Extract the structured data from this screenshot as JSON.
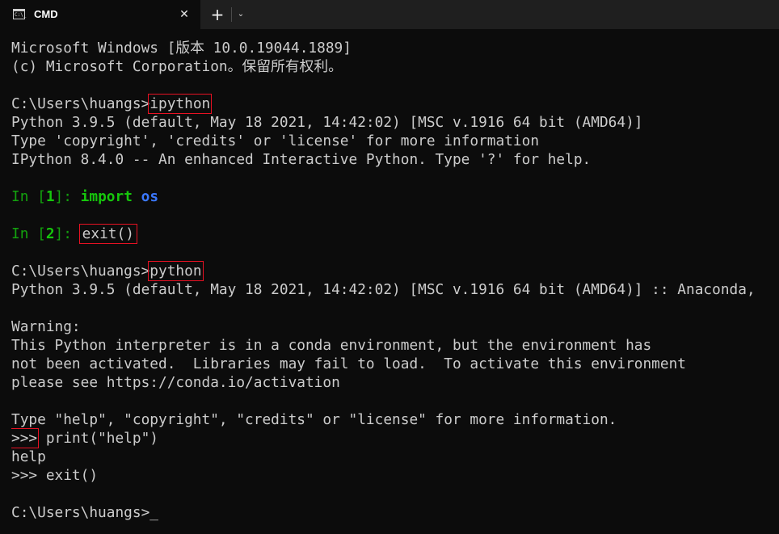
{
  "window": {
    "tab_title": "CMD",
    "tab_icon_text": "C:\\_",
    "close_glyph": "✕",
    "new_tab_glyph": "+",
    "dropdown_glyph": "⌄"
  },
  "terminal": {
    "banner_1": "Microsoft Windows [版本 10.0.19044.1889]",
    "banner_2": "(c) Microsoft Corporation。保留所有权利。",
    "prompt_1": "C:\\Users\\huangs>",
    "cmd_1": "ipython",
    "ipy_ver_1": "Python 3.9.5 (default, May 18 2021, 14:42:02) [MSC v.1916 64 bit (AMD64)]",
    "ipy_ver_2": "Type 'copyright', 'credits' or 'license' for more information",
    "ipy_ver_3": "IPython 8.4.0 -- An enhanced Interactive Python. Type '?' for help.",
    "in1_prefix": "In [",
    "in1_num": "1",
    "in1_suffix": "]: ",
    "in1_kw": "import",
    "in1_sp": " ",
    "in1_mod": "os",
    "in2_prefix": "In [",
    "in2_num": "2",
    "in2_suffix": "]: ",
    "in2_cmd": "exit()",
    "prompt_2": "C:\\Users\\huangs>",
    "cmd_2": "python",
    "py_ver": "Python 3.9.5 (default, May 18 2021, 14:42:02) [MSC v.1916 64 bit (AMD64)] :: Anaconda,",
    "warn_1": "Warning:",
    "warn_2": "This Python interpreter is in a conda environment, but the environment has",
    "warn_3": "not been activated.  Libraries may fail to load.  To activate this environment",
    "warn_4": "please see https://conda.io/activation",
    "py_help": "Type \"help\", \"copyright\", \"credits\" or \"license\" for more information.",
    "repl_prompt_1": ">>>",
    "repl_cmd_1": " print(\"help\")",
    "repl_out_1": "help",
    "repl_line_2": ">>> exit()",
    "prompt_3": "C:\\Users\\huangs>",
    "cursor": "_"
  },
  "colors": {
    "background": "#0c0c0c",
    "foreground": "#cccccc",
    "ipython_prompt": "#13a10e",
    "ipython_keyword": "#16c60c",
    "ipython_module": "#3b78ff",
    "highlight_box": "#e81123"
  }
}
